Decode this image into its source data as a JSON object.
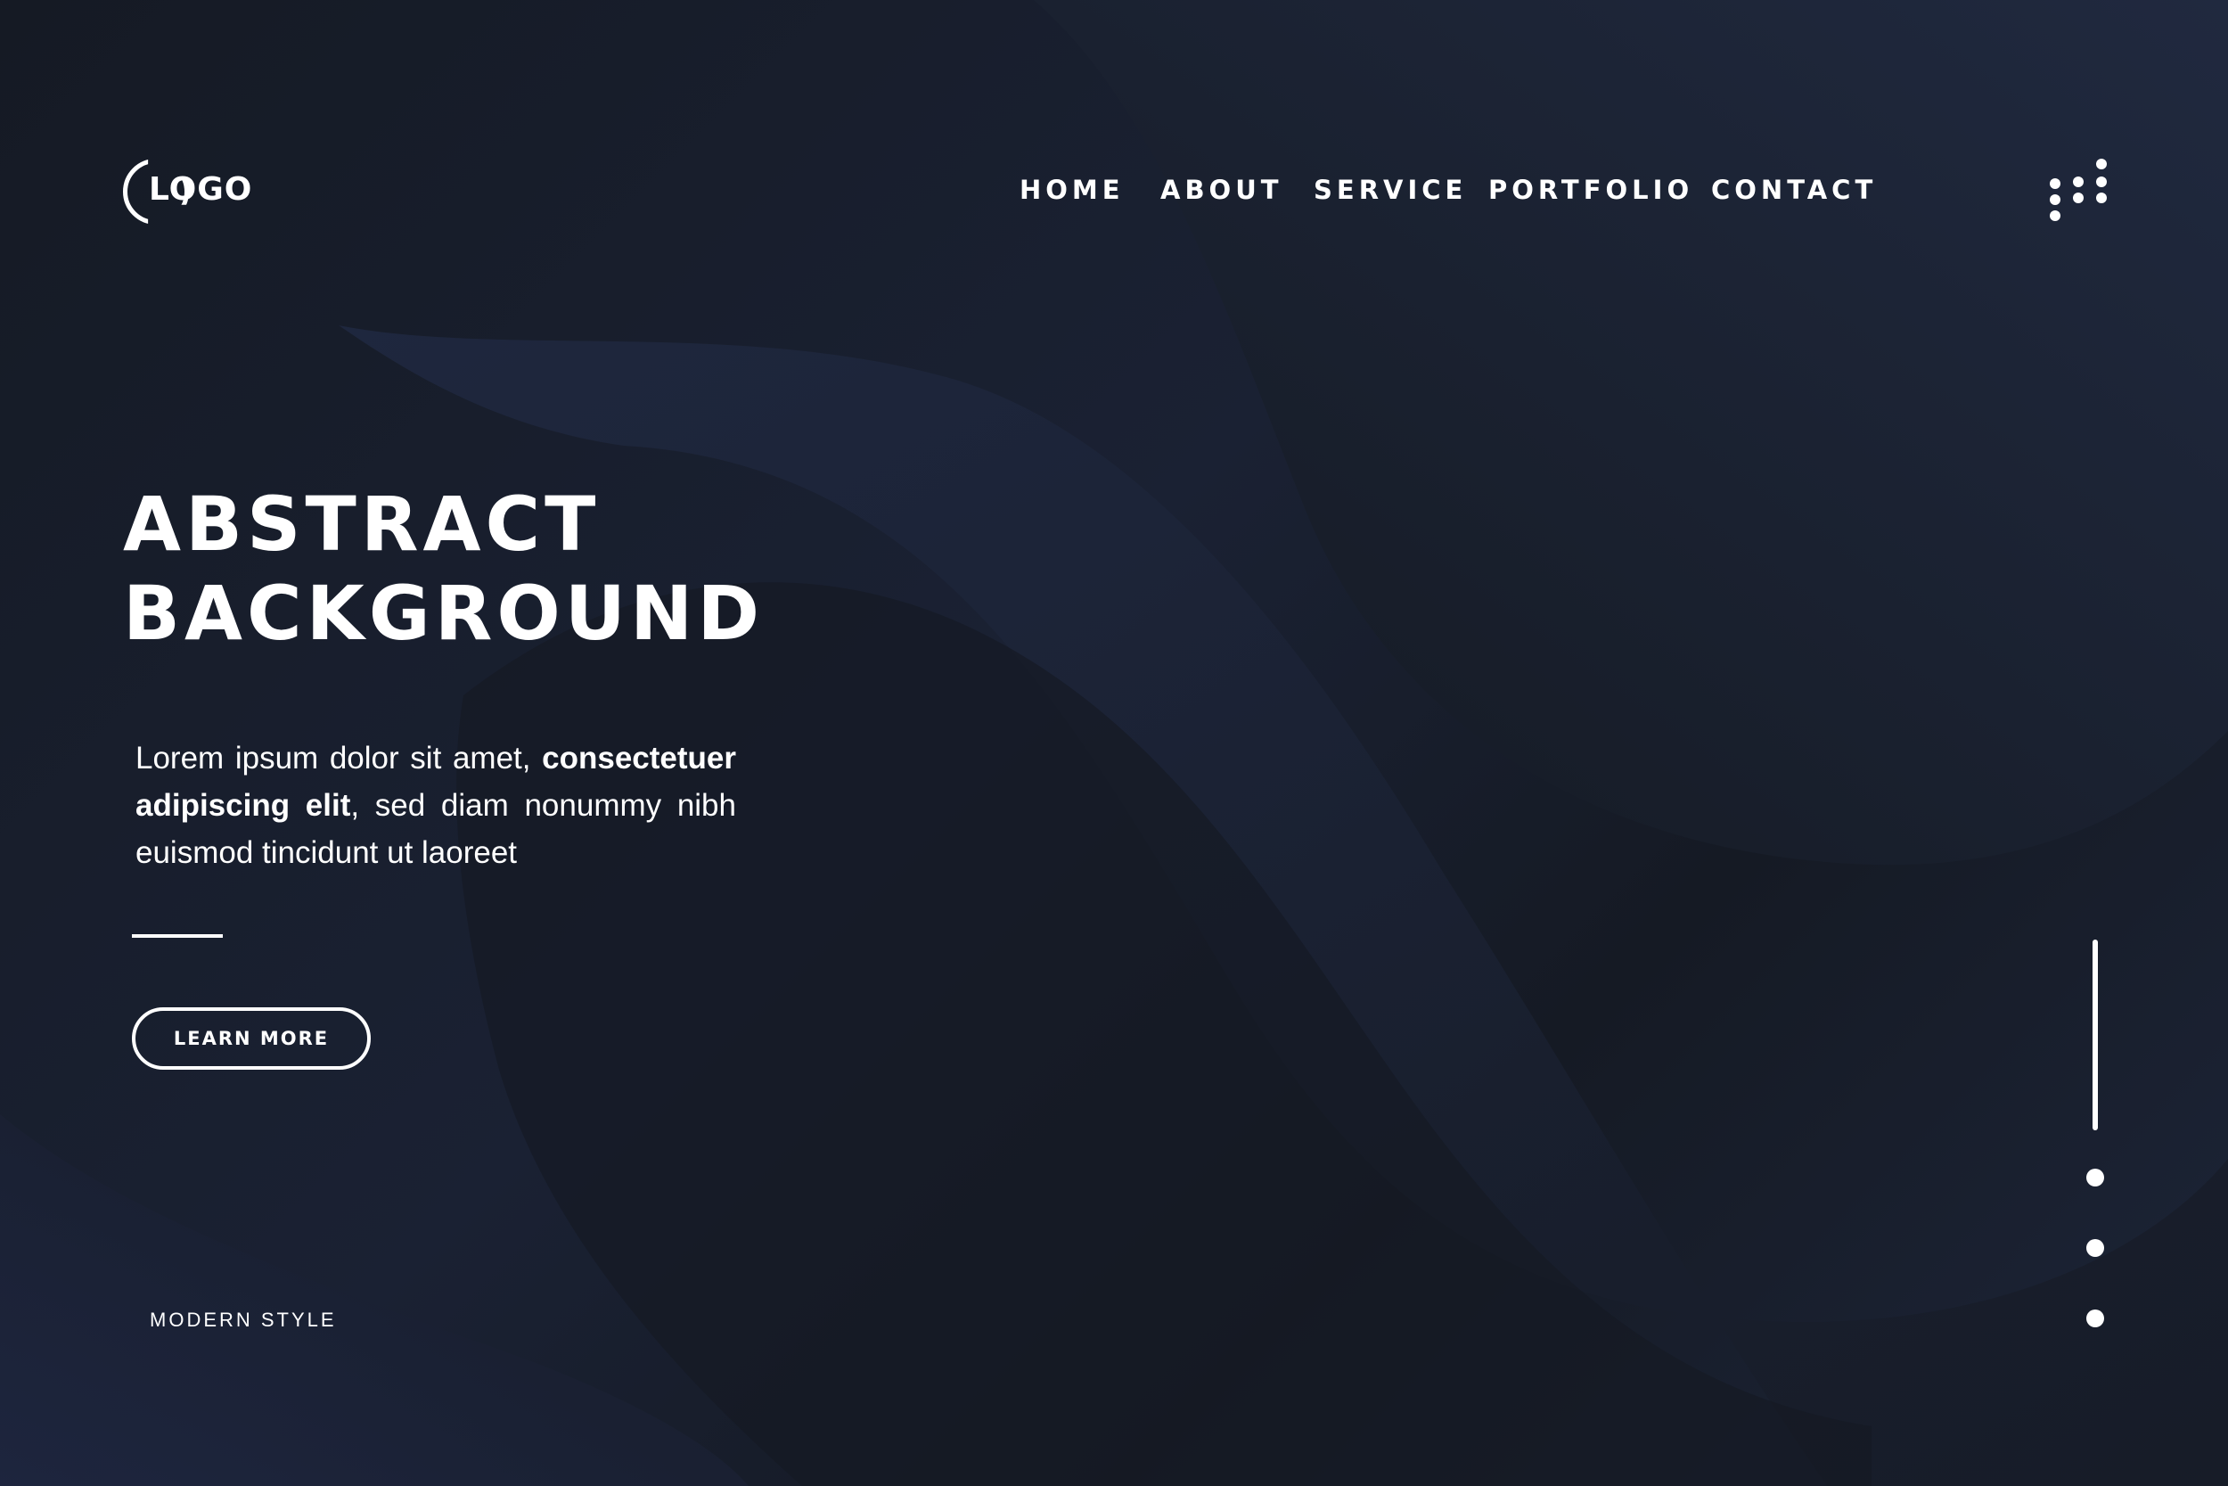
{
  "logo": {
    "text": "LOGO"
  },
  "nav": {
    "items": [
      {
        "label": "HOME"
      },
      {
        "label": "ABOUT"
      },
      {
        "label": "SERVICE"
      },
      {
        "label": "PORTFOLIO"
      },
      {
        "label": "CONTACT"
      }
    ]
  },
  "menu": {
    "icon": "dots-grid-icon"
  },
  "hero": {
    "title_line1": "ABSTRACT",
    "title_line2": "BACKGROUND",
    "text_part1": "Lorem ipsum dolor sit amet, ",
    "text_bold": "consectetuer adipiscing elit",
    "text_part2": ", sed diam nonummy nibh euismod tincidunt ut laoreet",
    "button_label": "LEARN MORE"
  },
  "footer": {
    "tag": "MODERN STYLE"
  },
  "pagination": {
    "active_page": 1,
    "page_count": 4
  },
  "colors": {
    "background": "#161b26",
    "wave": "#1f2840",
    "text": "#ffffff"
  }
}
